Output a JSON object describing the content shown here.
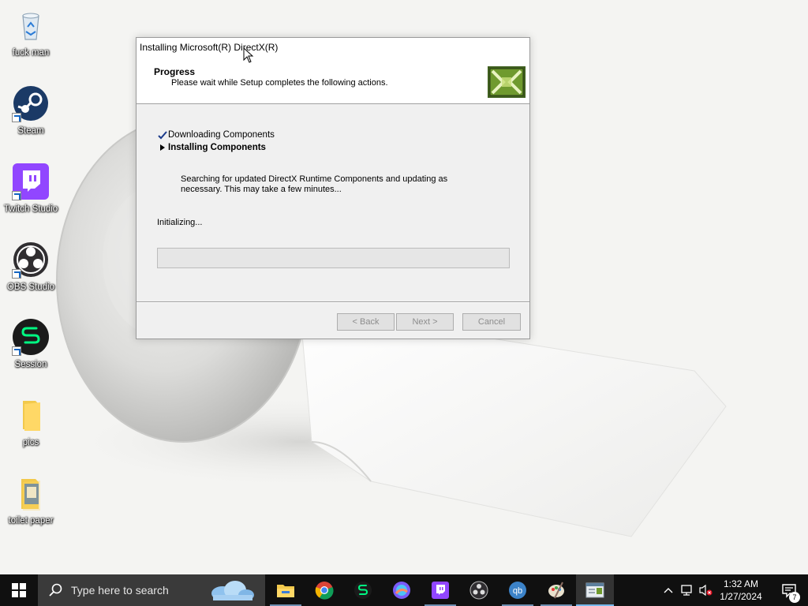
{
  "desktop": {
    "icons": [
      {
        "label": "fuck man",
        "icon": "recycle-bin-icon"
      },
      {
        "label": "Steam",
        "icon": "steam-icon"
      },
      {
        "label": "Twitch Studio",
        "icon": "twitch-studio-icon"
      },
      {
        "label": "OBS Studio",
        "icon": "obs-studio-icon"
      },
      {
        "label": "Session",
        "icon": "session-icon"
      },
      {
        "label": "pics",
        "icon": "folder-icon"
      },
      {
        "label": "toilet paper",
        "icon": "image-folder-icon"
      }
    ]
  },
  "dialog": {
    "title": "Installing Microsoft(R) DirectX(R)",
    "header_title": "Progress",
    "header_subtitle": "Please wait while Setup completes the following actions.",
    "logo_icon": "directx-logo-icon",
    "steps": [
      {
        "label": "Downloading Components",
        "state": "done"
      },
      {
        "label": "Installing Components",
        "state": "current"
      }
    ],
    "description": "Searching for updated DirectX Runtime Components and updating as necessary. This may take a few minutes...",
    "status": "Initializing...",
    "progress": 0,
    "buttons": {
      "back": "< Back",
      "next": "Next >",
      "cancel": "Cancel"
    },
    "buttons_enabled": false
  },
  "taskbar": {
    "start_icon": "windows-start-icon",
    "search_placeholder": "Type here to search",
    "apps": [
      {
        "name": "file-explorer-icon"
      },
      {
        "name": "chrome-icon"
      },
      {
        "name": "session-icon"
      },
      {
        "name": "browser-icon"
      },
      {
        "name": "twitch-studio-icon"
      },
      {
        "name": "obs-studio-icon"
      },
      {
        "name": "qbittorrent-icon"
      },
      {
        "name": "paint-icon"
      },
      {
        "name": "directx-setup-icon"
      }
    ],
    "tray_icons": [
      "chevron-up-icon",
      "network-icon",
      "volume-muted-icon"
    ],
    "time": "1:32 AM",
    "date": "1/27/2024",
    "notification_count": "7",
    "colors": {
      "background": "#101010",
      "search": "#3a3a3a",
      "accent": "#76b9ed"
    }
  }
}
